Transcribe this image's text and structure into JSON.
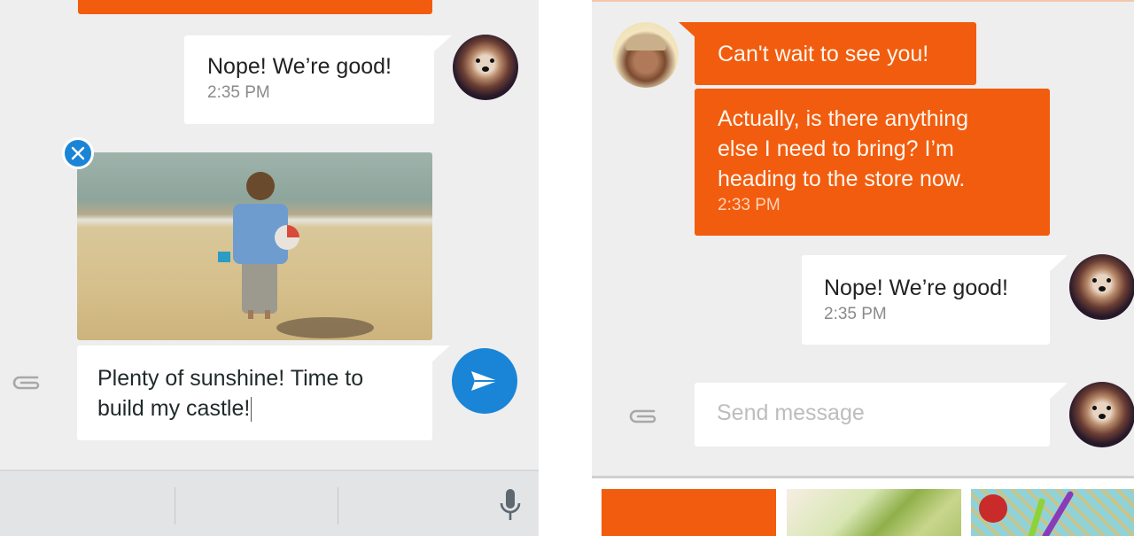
{
  "left_screen": {
    "conversation": [
      {
        "type": "outgoing",
        "text": "Nope! We’re good!",
        "time": "2:35 PM",
        "avatar": "dog-avatar"
      }
    ],
    "attachment": {
      "description": "Beach photo: person walking toward sea with bucket and beach ball",
      "remove_icon": "close-icon"
    },
    "composer": {
      "value": "Plenty of sunshine! Time to build my castle!",
      "line1": "Plenty of sunshine! Time to",
      "line2": "build my castle!",
      "attach_icon": "paperclip-icon",
      "send_icon": "send-icon"
    },
    "keyboard_bar": {
      "mic_icon": "microphone-icon"
    }
  },
  "right_screen": {
    "conversation": [
      {
        "type": "incoming",
        "text": "Can't wait to see you!",
        "avatar": "man-avatar"
      },
      {
        "type": "incoming",
        "lines": [
          "Actually, is there anything",
          "else I need to bring? I’m",
          "heading to the store now."
        ],
        "time": "2:33 PM"
      },
      {
        "type": "outgoing",
        "text": "Nope! We’re good!",
        "time": "2:35 PM",
        "avatar": "dog-avatar"
      }
    ],
    "composer": {
      "value": "",
      "placeholder": "Send message",
      "attach_icon": "paperclip-icon"
    },
    "media_tray": [
      "orange-color-tile",
      "grapes-photo",
      "fruit-and-spoons-photo"
    ]
  },
  "colors": {
    "accent_orange": "#f25c0e",
    "accent_blue": "#1a85d6",
    "background": "#eeeeee",
    "bubble": "#ffffff"
  }
}
